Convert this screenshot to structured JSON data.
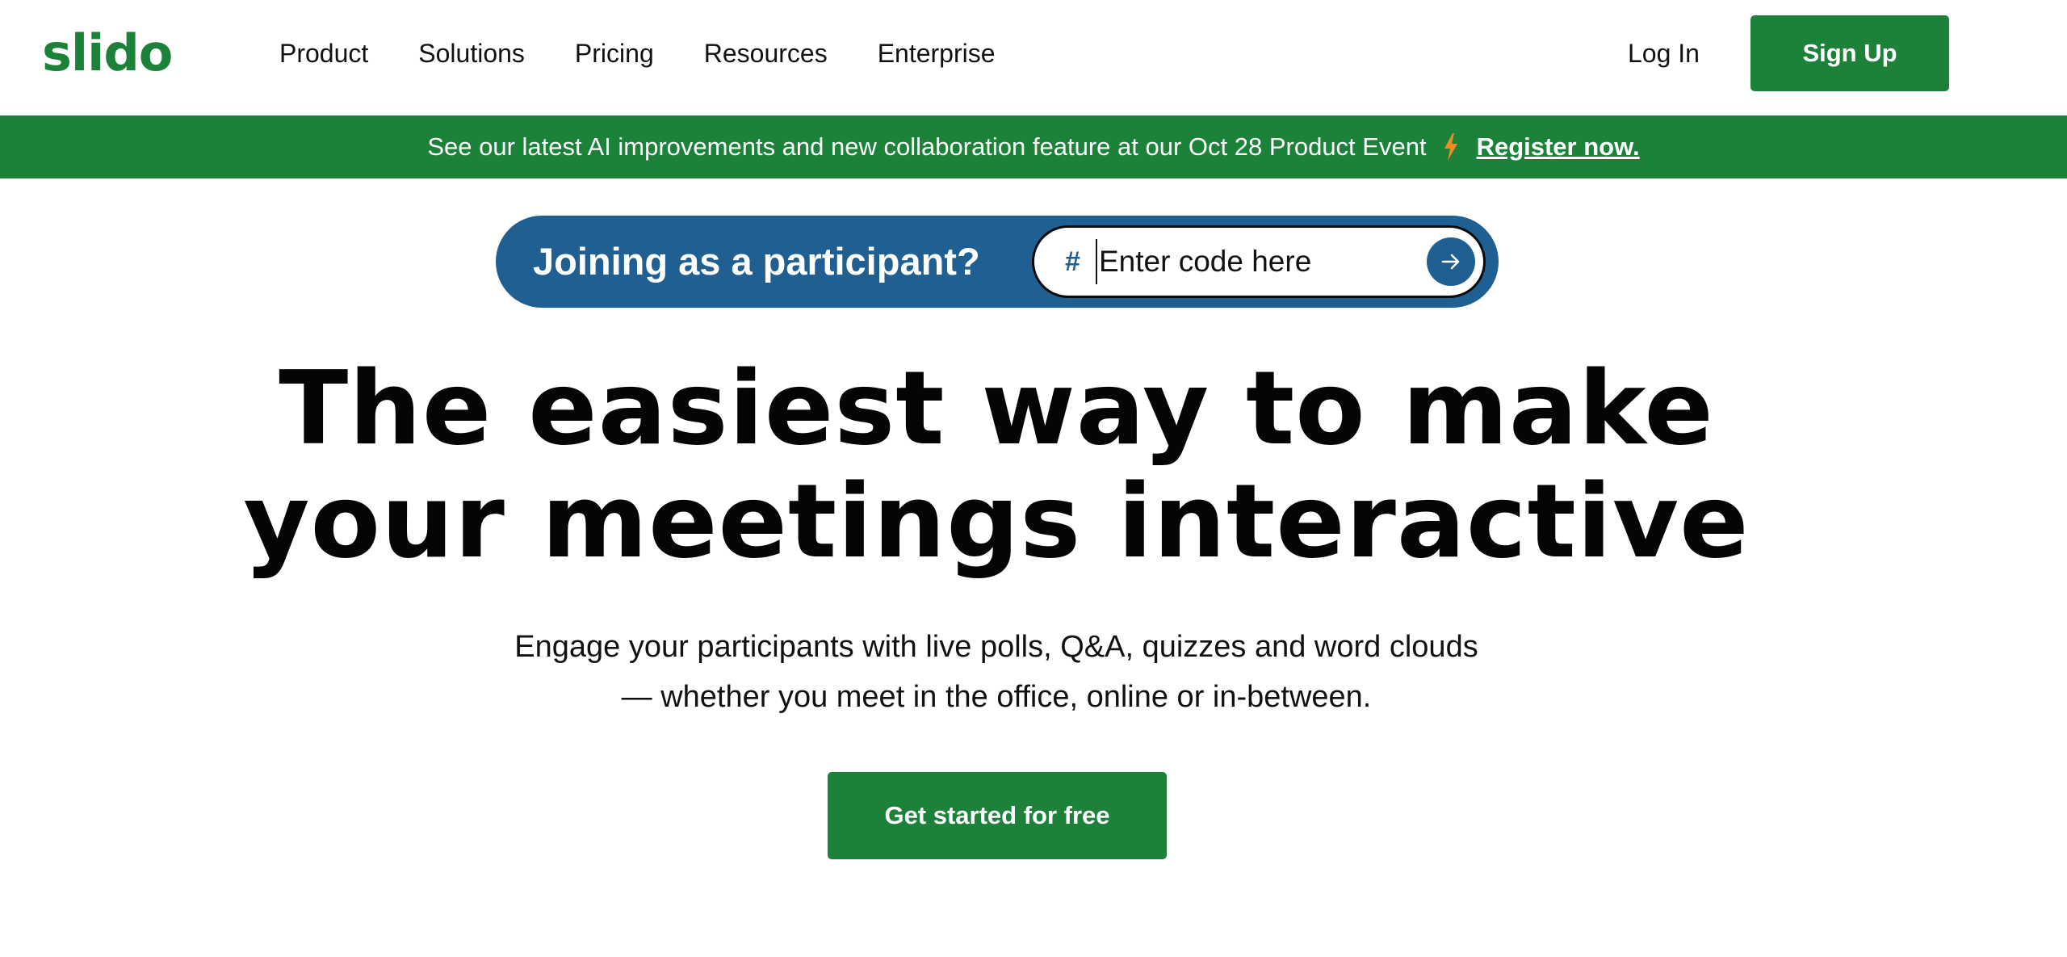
{
  "colors": {
    "brand_green": "#1c8239",
    "join_blue": "#1f5f92",
    "bolt_orange": "#f08a24"
  },
  "header": {
    "logo": "slido",
    "nav": [
      "Product",
      "Solutions",
      "Pricing",
      "Resources",
      "Enterprise"
    ],
    "login_label": "Log In",
    "signup_label": "Sign Up"
  },
  "banner": {
    "text": "See our latest AI improvements and new collaboration feature at our Oct 28 Product Event",
    "icon": "lightning-icon",
    "link_label": "Register now."
  },
  "join": {
    "label": "Joining as a participant?",
    "hash": "#",
    "placeholder": "Enter code here",
    "submit_icon": "arrow-right-icon"
  },
  "hero": {
    "title_line1": "The easiest way to make",
    "title_line2": "your meetings interactive",
    "subtitle_line1": "Engage your participants with live polls, Q&A, quizzes and word clouds",
    "subtitle_line2": "— whether you meet in the office, online or in-between.",
    "cta_label": "Get started for free"
  }
}
